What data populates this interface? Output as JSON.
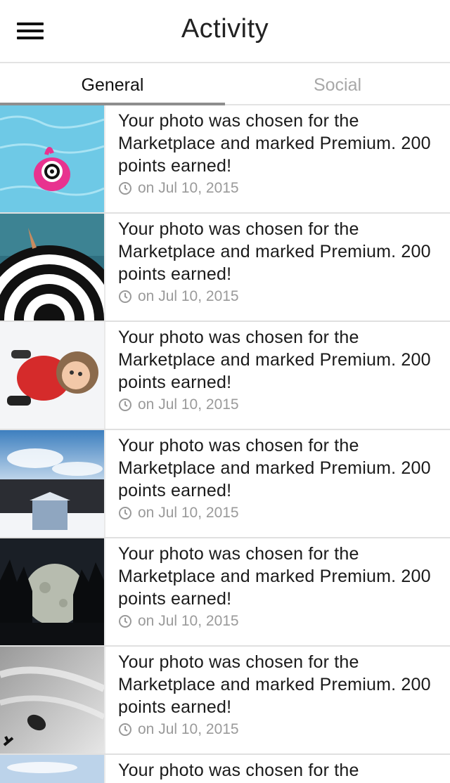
{
  "header": {
    "title": "Activity",
    "menu_icon": "hamburger-menu-icon"
  },
  "tabs": [
    {
      "label": "General",
      "active": true
    },
    {
      "label": "Social",
      "active": false
    }
  ],
  "activities": [
    {
      "message": "Your photo was chosen for the Marketplace and marked Premium. 200 points earned!",
      "date": "on Jul 10, 2015",
      "thumbnail": "pool-float-photo"
    },
    {
      "message": "Your photo was chosen for the Marketplace and marked Premium. 200 points earned!",
      "date": "on Jul 10, 2015",
      "thumbnail": "striped-umbrella-photo"
    },
    {
      "message": "Your photo was chosen for the Marketplace and marked Premium. 200 points earned!",
      "date": "on Jul 10, 2015",
      "thumbnail": "child-in-snow-photo"
    },
    {
      "message": "Your photo was chosen for the Marketplace and marked Premium. 200 points earned!",
      "date": "on Jul 10, 2015",
      "thumbnail": "winter-cabin-photo"
    },
    {
      "message": "Your photo was chosen for the Marketplace and marked Premium. 200 points earned!",
      "date": "on Jul 10, 2015",
      "thumbnail": "full-moon-road-photo"
    },
    {
      "message": "Your photo was chosen for the Marketplace and marked Premium. 200 points earned!",
      "date": "on Jul 10, 2015",
      "thumbnail": "satellite-dish-sky-photo"
    },
    {
      "message": "Your photo was chosen for the",
      "date": "",
      "thumbnail": "sky-photo"
    }
  ],
  "colors": {
    "active_tab": "#111111",
    "inactive_tab": "#a8a8a8",
    "meta_text": "#9a9a9a",
    "indicator": "#8e8e8e"
  }
}
